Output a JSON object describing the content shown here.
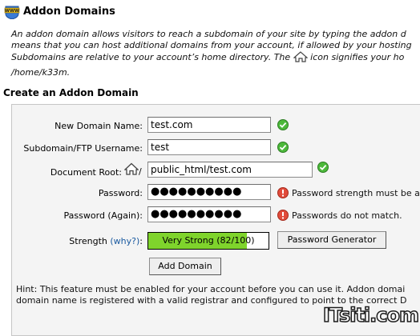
{
  "header": {
    "title": "Addon Domains"
  },
  "intro": {
    "line1": "An addon domain allows visitors to reach a subdomain of your site by typing the addon d",
    "line2": "means that you can host additional domains from your account, if allowed by your hosting",
    "line3_before": "Subdomains are relative to your account’s home directory. The",
    "line3_after": "icon signifies your ho"
  },
  "home_path": "/home/k33m.",
  "section": {
    "title": "Create an Addon Domain"
  },
  "form": {
    "new_domain": {
      "label": "New Domain Name:",
      "value": "test.com"
    },
    "subdomain": {
      "label": "Subdomain/FTP Username:",
      "value": "test"
    },
    "docroot": {
      "label": "Document Root:",
      "separator": "/",
      "value": "public_html/test.com"
    },
    "password": {
      "label": "Password:",
      "masked": "●●●●●●●●●●",
      "message": "Password strength must be at lea"
    },
    "password_again": {
      "label": "Password (Again):",
      "masked": "●●●●●●●●●●",
      "message": "Passwords do not match."
    },
    "strength": {
      "label": "Strength",
      "help_link": "(why?)",
      "colon": ":",
      "text": "Very Strong (82/100)",
      "percent": 82,
      "fill_color": "#7fd42c"
    },
    "password_generator_label": "Password Generator",
    "add_domain_label": "Add Domain"
  },
  "hint": {
    "line1": "Hint: This feature must be enabled for your account before you can use it. Addon domai",
    "line2": "domain name is registered with a valid registrar and configured to point to the correct D"
  },
  "watermark": {
    "text": "ITsiti.com"
  }
}
